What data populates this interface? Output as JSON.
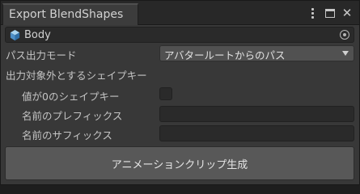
{
  "window": {
    "title": "Export BlendShapes"
  },
  "object_field": {
    "value": "Body"
  },
  "path_mode": {
    "label": "パス出力モード",
    "selected": "アバタールートからのパス"
  },
  "exclude_section": {
    "header": "出力対象外とするシェイプキー",
    "zero_value_label": "値が0のシェイプキー",
    "zero_value_checked": false,
    "prefix_label": "名前のプレフィックス",
    "prefix_value": "",
    "suffix_label": "名前のサフィックス",
    "suffix_value": ""
  },
  "actions": {
    "generate_label": "アニメーションクリップ生成"
  }
}
